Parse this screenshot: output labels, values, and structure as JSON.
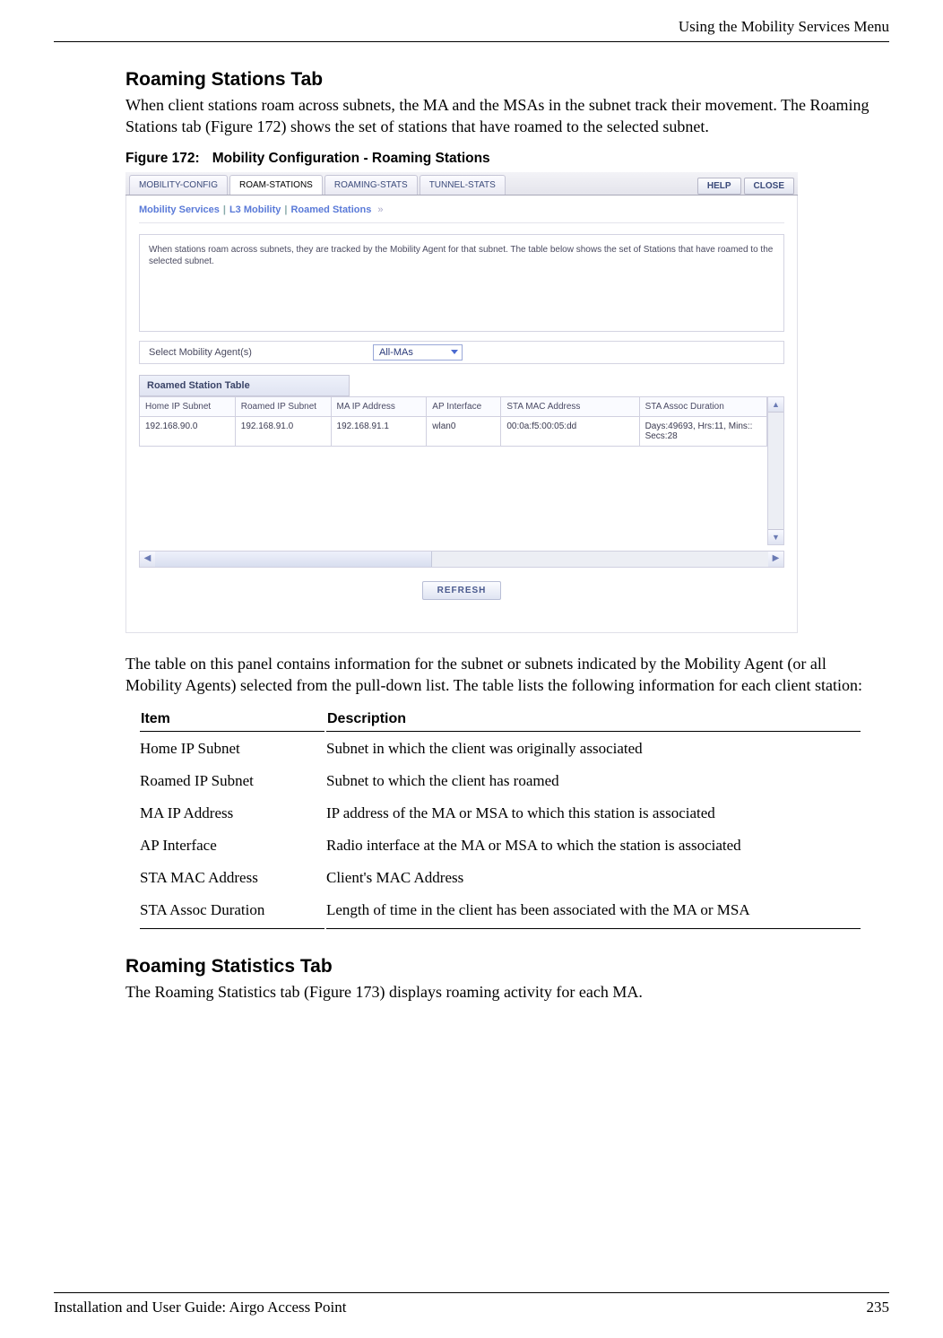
{
  "header": {
    "running_head": "Using the Mobility Services Menu"
  },
  "section1": {
    "title": "Roaming Stations Tab",
    "para": "When client stations roam across subnets, the MA and the MSAs in the subnet track their movement. The Roaming Stations tab (Figure 172) shows the set of stations that have roamed to the selected subnet."
  },
  "figure": {
    "caption_num": "Figure 172:",
    "caption_text": "Mobility Configuration - Roaming Stations",
    "tabs": [
      "MOBILITY-CONFIG",
      "ROAM-STATIONS",
      "ROAMING-STATS",
      "TUNNEL-STATS"
    ],
    "active_tab_index": 1,
    "help_label": "HELP",
    "close_label": "CLOSE",
    "breadcrumb": [
      "Mobility Services",
      "L3 Mobility",
      "Roamed Stations"
    ],
    "info_text": "When stations roam across subnets, they are tracked by the Mobility Agent for that subnet. The table below shows the set of Stations that have roamed to the selected subnet.",
    "select_label": "Select Mobility Agent(s)",
    "select_value": "All-MAs",
    "table_title": "Roamed Station Table",
    "columns": [
      "Home IP Subnet",
      "Roamed IP Subnet",
      "MA IP Address",
      "AP Interface",
      "STA MAC Address",
      "STA Assoc Duration"
    ],
    "rows": [
      [
        "192.168.90.0",
        "192.168.91.0",
        "192.168.91.1",
        "wlan0",
        "00:0a:f5:00:05:dd",
        "Days:49693, Hrs:11, Mins:: Secs:28"
      ]
    ],
    "refresh_label": "REFRESH"
  },
  "after_figure_para": "The table on this panel contains information for the subnet or subnets indicated by the Mobility Agent (or all Mobility Agents) selected from the pull-down list. The table lists the following information for each client station:",
  "desc_table": {
    "head_item": "Item",
    "head_desc": "Description",
    "rows": [
      {
        "item": "Home IP Subnet",
        "desc": " Subnet in which the client was originally associated"
      },
      {
        "item": "Roamed IP Subnet",
        "desc": "Subnet to which the client has roamed"
      },
      {
        "item": "MA IP Address",
        "desc": "IP address of the MA or MSA to which this station is associated"
      },
      {
        "item": "AP Interface",
        "desc": "Radio interface at the MA or MSA to which the station is associated"
      },
      {
        "item": "STA MAC Address",
        "desc": "Client's MAC Address"
      },
      {
        "item": "STA Assoc Duration",
        "desc": "Length of time in the client has been associated with the MA or MSA"
      }
    ]
  },
  "section2": {
    "title": "Roaming Statistics Tab",
    "para": "The Roaming Statistics tab (Figure 173) displays roaming activity for each MA."
  },
  "footer": {
    "left": "Installation and User Guide: Airgo Access Point",
    "right": "235"
  }
}
